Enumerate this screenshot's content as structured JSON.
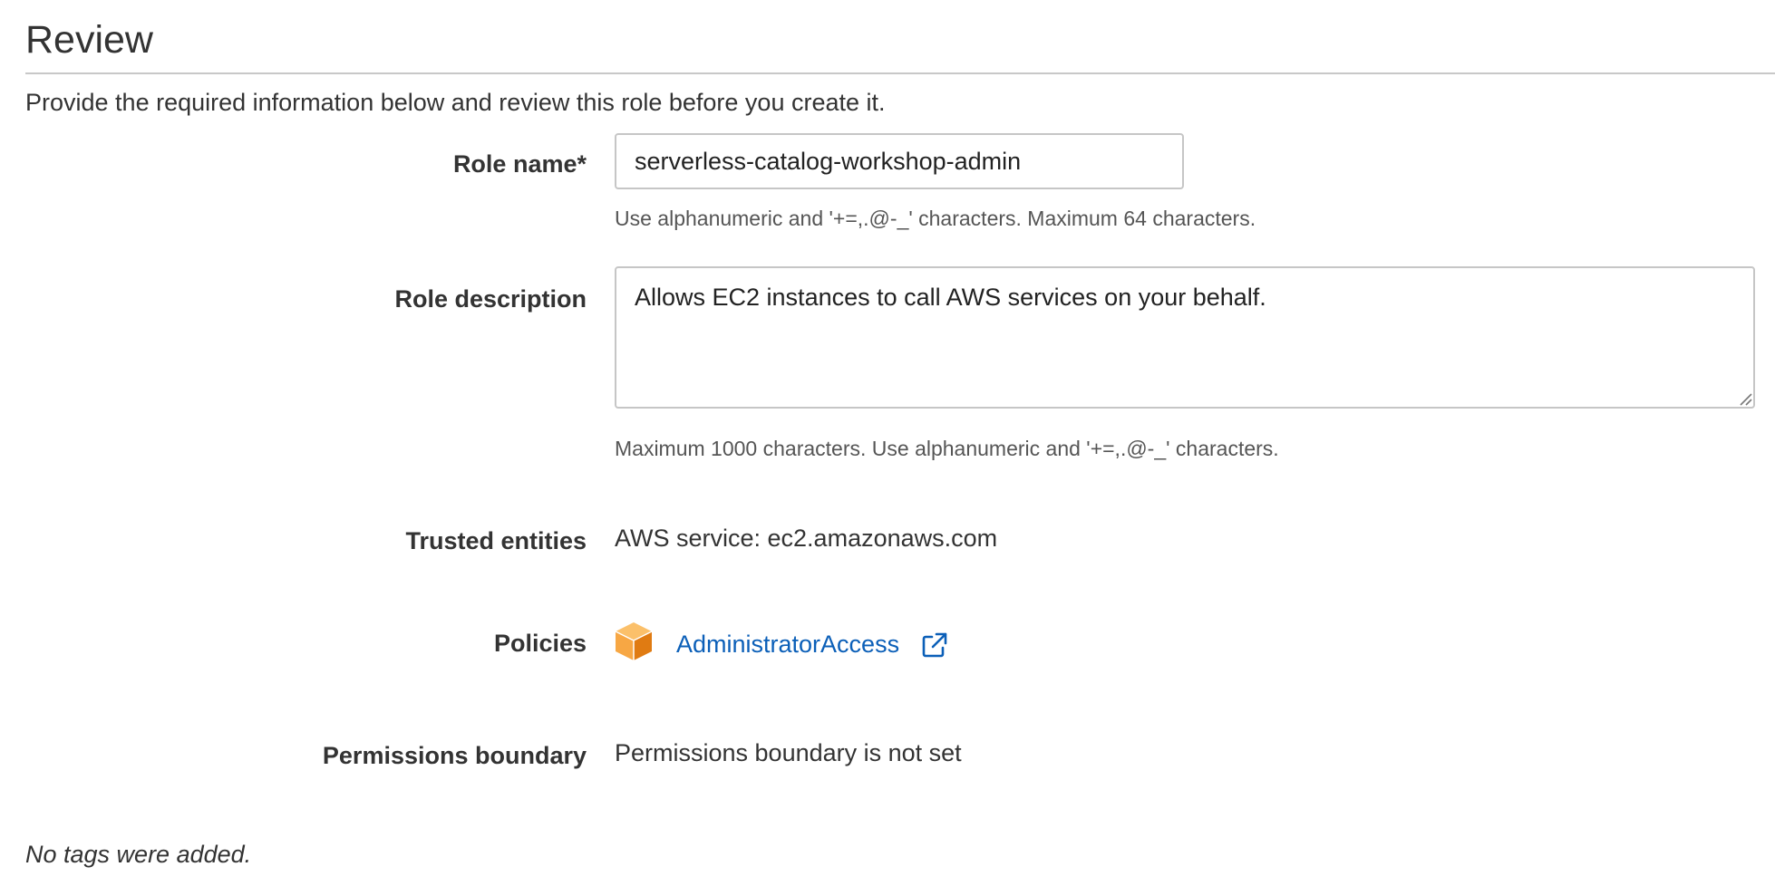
{
  "header": {
    "title": "Review",
    "intro": "Provide the required information below and review this role before you create it."
  },
  "form": {
    "role_name": {
      "label": "Role name*",
      "value": "serverless-catalog-workshop-admin",
      "help": "Use alphanumeric and '+=,.@-_' characters. Maximum 64 characters."
    },
    "role_description": {
      "label": "Role description",
      "value": "Allows EC2 instances to call AWS services on your behalf.",
      "help": "Maximum 1000 characters. Use alphanumeric and '+=,.@-_' characters."
    },
    "trusted_entities": {
      "label": "Trusted entities",
      "value": "AWS service: ec2.amazonaws.com"
    },
    "policies": {
      "label": "Policies",
      "items": [
        {
          "name": "AdministratorAccess",
          "icon": "policy-cube-icon",
          "link_icon": "external-link-icon"
        }
      ]
    },
    "permissions_boundary": {
      "label": "Permissions boundary",
      "value": "Permissions boundary is not set"
    }
  },
  "tags": {
    "note": "No tags were added."
  },
  "colors": {
    "link": "#0b5fb8",
    "cube_light": "#f7a744",
    "cube_dark": "#e07b12",
    "border": "#c6c6c6"
  }
}
